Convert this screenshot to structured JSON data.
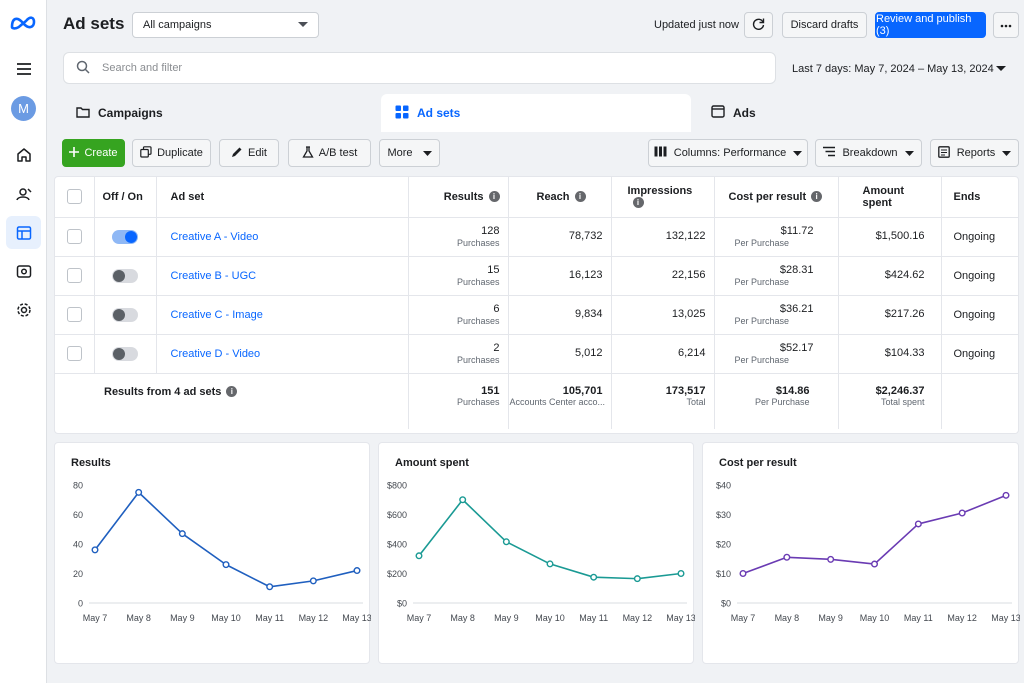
{
  "header": {
    "title": "Ad sets",
    "campaign_select": "All campaigns",
    "updated": "Updated just now",
    "discard": "Discard drafts",
    "publish": "Review and publish (3)"
  },
  "rail": {
    "avatar": "M"
  },
  "search": {
    "placeholder": "Search and filter",
    "date_range": "Last 7 days: May 7, 2024 – May 13, 2024"
  },
  "tabs": [
    {
      "label": "Campaigns"
    },
    {
      "label": "Ad sets"
    },
    {
      "label": "Ads"
    }
  ],
  "toolbar": {
    "create": "Create",
    "duplicate": "Duplicate",
    "edit": "Edit",
    "ab_test": "A/B test",
    "more": "More",
    "columns": "Columns: Performance",
    "breakdown": "Breakdown",
    "reports": "Reports"
  },
  "table": {
    "headers": {
      "off_on": "Off / On",
      "ad_set": "Ad set",
      "results": "Results",
      "reach": "Reach",
      "impressions": "Impressions",
      "cost": "Cost per result",
      "spent": "Amount spent",
      "ends": "Ends"
    },
    "rows": [
      {
        "on": true,
        "name": "Creative A - Video",
        "results": "128",
        "results_sub": "Purchases",
        "reach": "78,732",
        "impressions": "132,122",
        "cost": "$11.72",
        "cost_sub": "Per Purchase",
        "spent": "$1,500.16",
        "ends": "Ongoing"
      },
      {
        "on": false,
        "name": "Creative B - UGC",
        "results": "15",
        "results_sub": "Purchases",
        "reach": "16,123",
        "impressions": "22,156",
        "cost": "$28.31",
        "cost_sub": "Per Purchase",
        "spent": "$424.62",
        "ends": "Ongoing"
      },
      {
        "on": false,
        "name": "Creative C - Image",
        "results": "6",
        "results_sub": "Purchases",
        "reach": "9,834",
        "impressions": "13,025",
        "cost": "$36.21",
        "cost_sub": "Per Purchase",
        "spent": "$217.26",
        "ends": "Ongoing"
      },
      {
        "on": false,
        "name": "Creative D - Video",
        "results": "2",
        "results_sub": "Purchases",
        "reach": "5,012",
        "impressions": "6,214",
        "cost": "$52.17",
        "cost_sub": "Per Purchase",
        "spent": "$104.33",
        "ends": "Ongoing"
      }
    ],
    "totals": {
      "label": "Results from 4 ad sets",
      "results": "151",
      "results_sub": "Purchases",
      "reach": "105,701",
      "reach_sub": "Accounts Center acco...",
      "impressions": "173,517",
      "impressions_sub": "Total",
      "cost": "$14.86",
      "cost_sub": "Per Purchase",
      "spent": "$2,246.37",
      "spent_sub": "Total spent"
    }
  },
  "colors": {
    "blue": "#0866ff",
    "chart1": "#1f5fbf",
    "chart2": "#1a9a94",
    "chart3": "#6a3bb3"
  },
  "chart_data": [
    {
      "type": "line",
      "title": "Results",
      "categories": [
        "May 7",
        "May 8",
        "May 9",
        "May 10",
        "May 11",
        "May 12",
        "May 13"
      ],
      "values": [
        36,
        75,
        47,
        26,
        11,
        15,
        22
      ],
      "ylim": [
        0,
        80
      ],
      "yticks": [
        "0",
        "20",
        "40",
        "60",
        "80"
      ],
      "color": "#1f5fbf"
    },
    {
      "type": "line",
      "title": "Amount spent",
      "categories": [
        "May 7",
        "May 8",
        "May 9",
        "May 10",
        "May 11",
        "May 12",
        "May 13"
      ],
      "values": [
        320,
        700,
        415,
        265,
        175,
        165,
        200
      ],
      "ylim": [
        0,
        800
      ],
      "yticks": [
        "$0",
        "$200",
        "$400",
        "$600",
        "$800"
      ],
      "color": "#1a9a94"
    },
    {
      "type": "line",
      "title": "Cost per result",
      "categories": [
        "May 7",
        "May 8",
        "May 9",
        "May 10",
        "May 11",
        "May 12",
        "May 13"
      ],
      "values": [
        10,
        15.5,
        14.8,
        13.2,
        26.8,
        30.5,
        36.5
      ],
      "ylim": [
        0,
        40
      ],
      "yticks": [
        "$0",
        "$10",
        "$20",
        "$30",
        "$40"
      ],
      "color": "#6a3bb3"
    }
  ]
}
